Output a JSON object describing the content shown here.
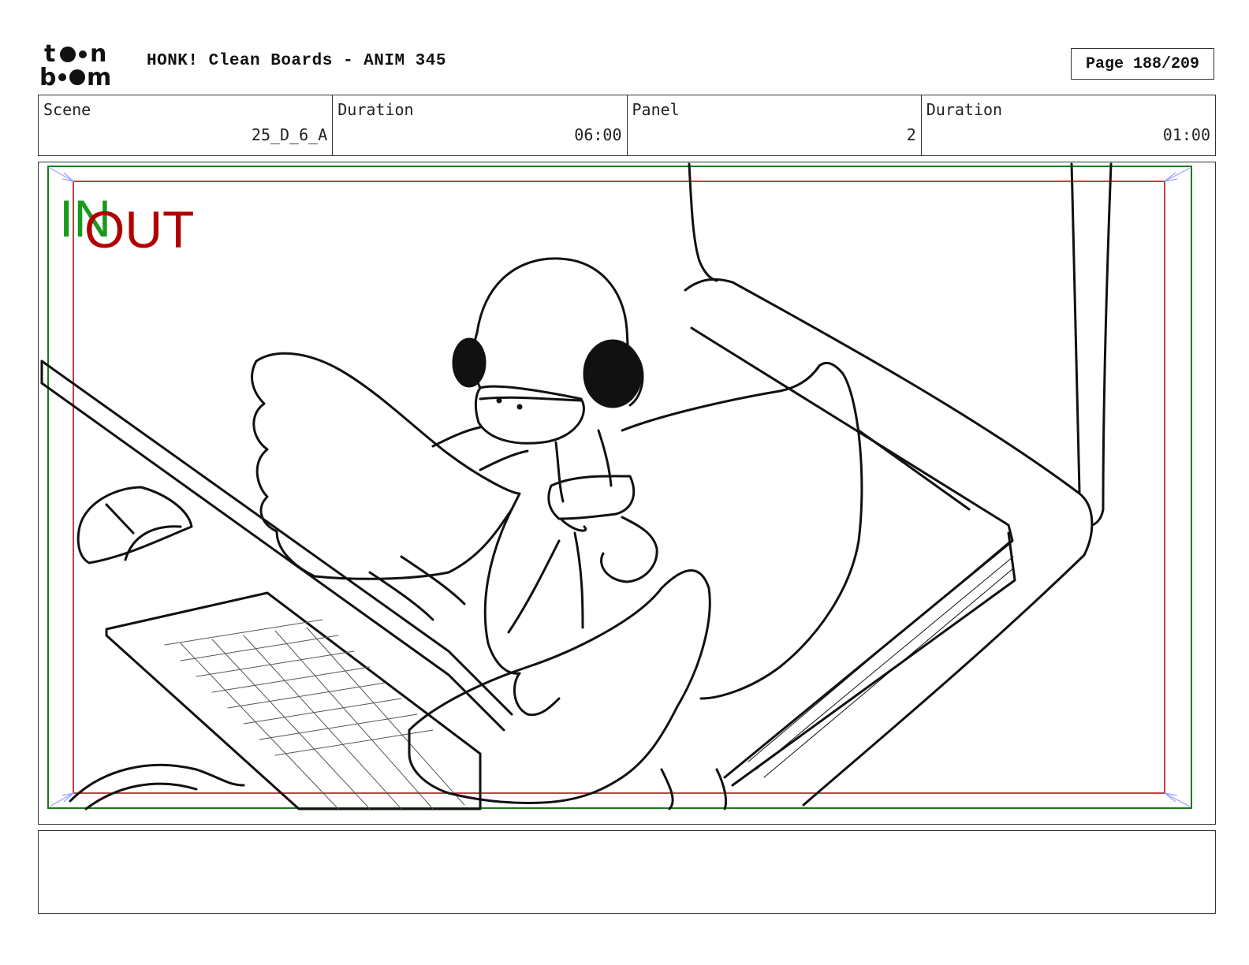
{
  "header": {
    "title": "HONK! Clean Boards - ANIM 345",
    "page": "Page 188/209"
  },
  "info": {
    "scene_label": "Scene",
    "scene_value": "25_D_6_A",
    "scene_duration_label": "Duration",
    "scene_duration_value": "06:00",
    "panel_label": "Panel",
    "panel_value": "2",
    "panel_duration_label": "Duration",
    "panel_duration_value": "01:00"
  },
  "panel": {
    "in_label": "IN",
    "out_label": "OUT",
    "in_color": "#1a9a1a",
    "out_color": "#b00000"
  },
  "notes": {
    "text": ""
  }
}
